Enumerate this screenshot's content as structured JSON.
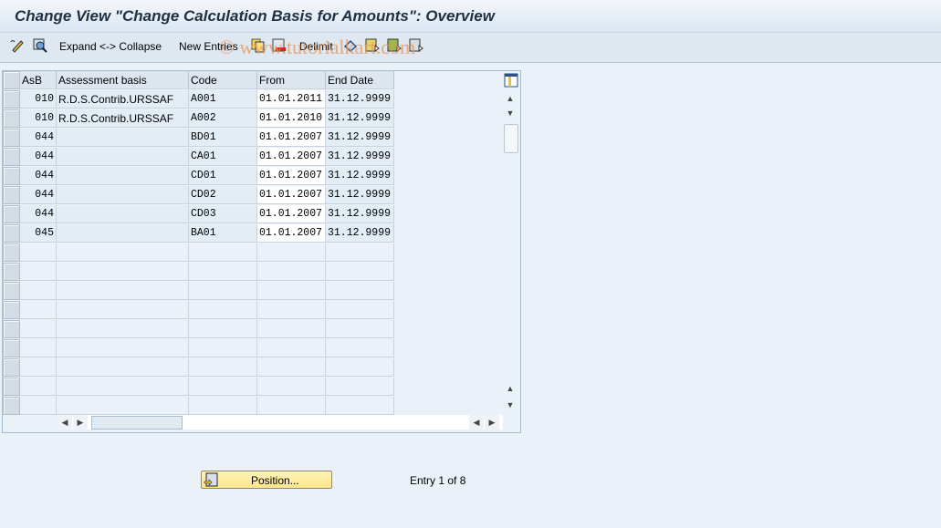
{
  "title": "Change View \"Change Calculation Basis for Amounts\": Overview",
  "watermark": "© www.tutorialkart.com",
  "toolbar": {
    "expand_collapse": "Expand <-> Collapse",
    "new_entries": "New Entries",
    "delimit": "Delimit",
    "icons": [
      "display-change-icon",
      "details-icon",
      "copy-icon",
      "delete-icon",
      "undo-icon",
      "select-all-icon",
      "select-block-icon",
      "deselect-all-icon"
    ]
  },
  "table": {
    "columns": [
      "AsB",
      "Assessment basis",
      "Code",
      "From",
      "End Date"
    ],
    "rows": [
      [
        "010",
        "R.D.S.Contrib.URSSAF",
        "A001",
        "01.01.2011",
        "31.12.9999"
      ],
      [
        "010",
        "R.D.S.Contrib.URSSAF",
        "A002",
        "01.01.2010",
        "31.12.9999"
      ],
      [
        "044",
        "",
        "BD01",
        "01.01.2007",
        "31.12.9999"
      ],
      [
        "044",
        "",
        "CA01",
        "01.01.2007",
        "31.12.9999"
      ],
      [
        "044",
        "",
        "CD01",
        "01.01.2007",
        "31.12.9999"
      ],
      [
        "044",
        "",
        "CD02",
        "01.01.2007",
        "31.12.9999"
      ],
      [
        "044",
        "",
        "CD03",
        "01.01.2007",
        "31.12.9999"
      ],
      [
        "045",
        "",
        "BA01",
        "01.01.2007",
        "31.12.9999"
      ]
    ],
    "empty_rows": 9
  },
  "footer": {
    "position_button": "Position...",
    "entry_text": "Entry 1 of 8"
  }
}
